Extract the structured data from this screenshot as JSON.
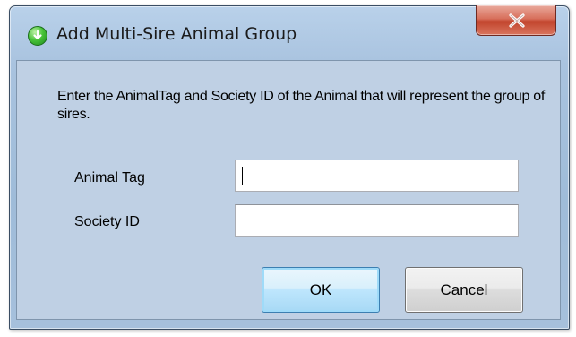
{
  "window": {
    "title": "Add Multi-Sire Animal Group",
    "title_icon": "green-circle-arrow-icon",
    "close_icon": "close-x-icon"
  },
  "dialog": {
    "message": "Enter the AnimalTag and Society ID of the Animal that will represent the group of sires.",
    "fields": {
      "animal_tag": {
        "label": "Animal Tag",
        "value": ""
      },
      "society_id": {
        "label": "Society ID",
        "value": ""
      }
    },
    "buttons": {
      "ok": "OK",
      "cancel": "Cancel"
    }
  },
  "colors": {
    "frame": "#a9c3df",
    "client": "#bfd0e4",
    "close_button": "#c2452d",
    "default_button_border": "#3c7fb1"
  }
}
